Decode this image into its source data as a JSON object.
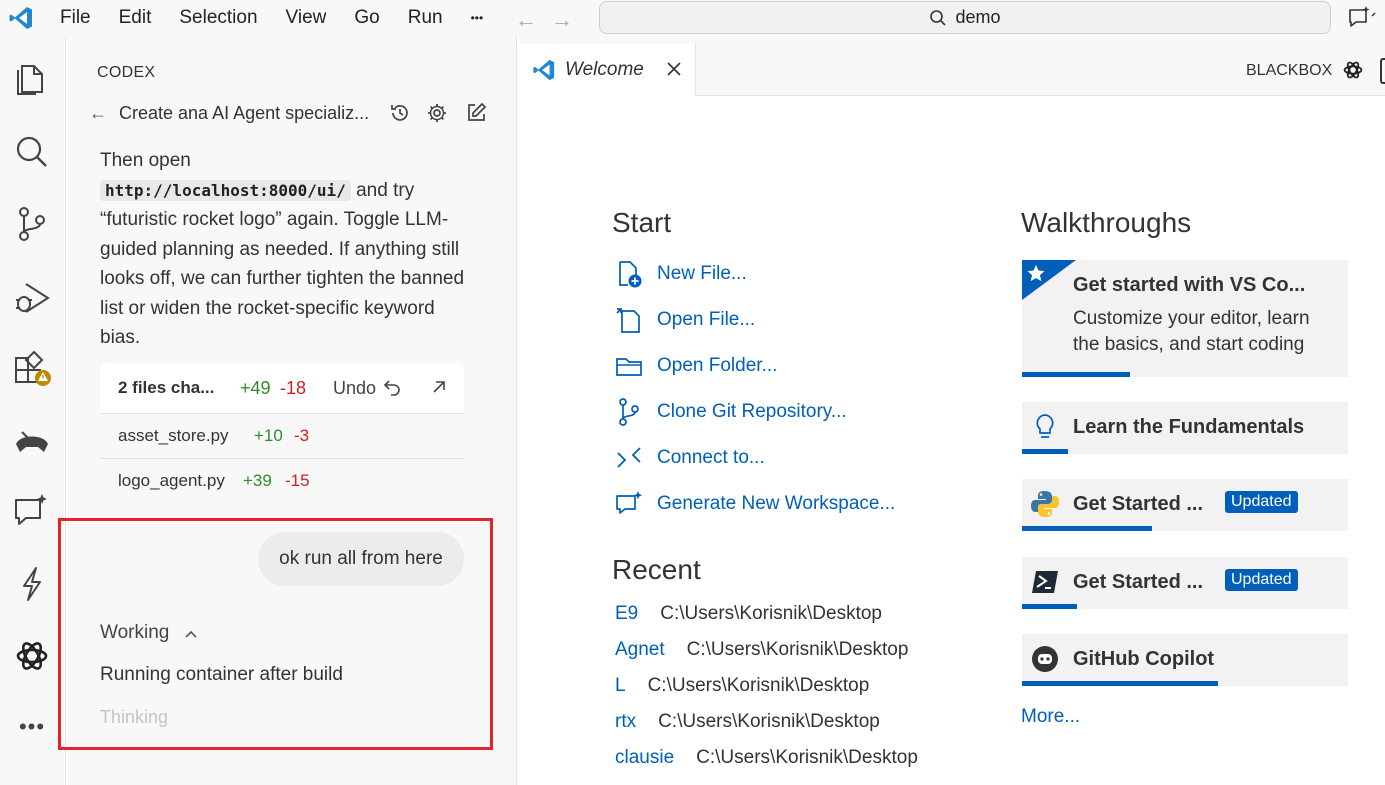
{
  "titlebar": {
    "menu": [
      "File",
      "Edit",
      "Selection",
      "View",
      "Go",
      "Run",
      "•••"
    ],
    "search_text": "demo"
  },
  "panel": {
    "title": "CODEX",
    "breadcrumb": "Create ana AI Agent specializ...",
    "message_pre": "Then open",
    "message_code": "http://localhost:8000/ui/",
    "message_post": "and try “futuristic rocket logo” again. Toggle LLM-guided planning as needed. If anything still looks off, we can further tighten the banned list or widen the rocket-specific keyword bias.",
    "files": {
      "label": "2 files cha...",
      "plus": "+49",
      "minus": "-18",
      "undo": "Undo",
      "rows": [
        {
          "name": "asset_store.py",
          "plus": "+10",
          "minus": "-3"
        },
        {
          "name": "logo_agent.py",
          "plus": "+39",
          "minus": "-15"
        }
      ]
    },
    "user_message": "ok run all from here",
    "working": "Working",
    "status": "Running container after build",
    "thinking": "Thinking"
  },
  "editor": {
    "tab_label": "Welcome",
    "blackbox": "BLACKBOX",
    "start_heading": "Start",
    "start_items": [
      "New File...",
      "Open File...",
      "Open Folder...",
      "Clone Git Repository...",
      "Connect to...",
      "Generate New Workspace..."
    ],
    "recent_heading": "Recent",
    "recent": [
      {
        "name": "E9",
        "path": "C:\\Users\\Korisnik\\Desktop"
      },
      {
        "name": "Agnet",
        "path": "C:\\Users\\Korisnik\\Desktop"
      },
      {
        "name": "L",
        "path": "C:\\Users\\Korisnik\\Desktop"
      },
      {
        "name": "rtx",
        "path": "C:\\Users\\Korisnik\\Desktop"
      },
      {
        "name": "clausie",
        "path": "C:\\Users\\Korisnik\\Desktop"
      }
    ],
    "walk_heading": "Walkthroughs",
    "walkthroughs": [
      {
        "title": "Get started with VS Co...",
        "desc": "Customize your editor, learn the basics, and start coding",
        "progress": 0.33
      },
      {
        "title": "Learn the Fundamentals",
        "progress": 0.14
      },
      {
        "title": "Get Started ...",
        "badge": "Updated",
        "progress": 0.4
      },
      {
        "title": "Get Started ...",
        "badge": "Updated",
        "progress": 0.17
      },
      {
        "title": "GitHub Copilot",
        "progress": 0.6
      }
    ],
    "more": "More..."
  },
  "colors": {
    "accent": "#005fb8",
    "highlight_box": "#e3242b",
    "add": "#2e8b2e",
    "remove": "#d02020"
  }
}
